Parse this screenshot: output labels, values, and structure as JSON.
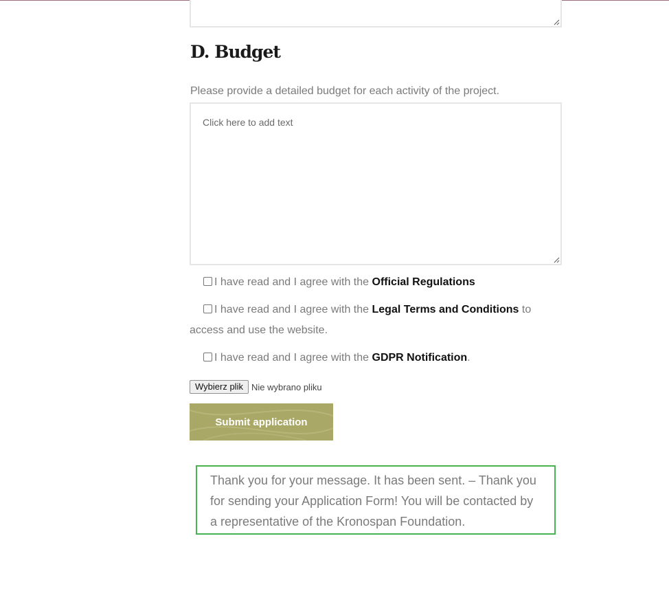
{
  "section": {
    "heading": "D. Budget",
    "instruction": "Please provide a detailed budget for each activity of the project.",
    "budget_placeholder": "Click here to add text"
  },
  "agreements": {
    "prefix": "I have read and I agree with the",
    "regulations_link": "Official Regulations",
    "terms_link": "Legal Terms and Conditions",
    "terms_suffix": "to access and use the website.",
    "gdpr_link": "GDPR Notification",
    "gdpr_suffix": "."
  },
  "file_upload": {
    "button_label": "Wybierz plik",
    "status": "Nie wybrano pliku"
  },
  "submit": {
    "label": "Submit application",
    "color": "#a9a866"
  },
  "response": {
    "message": "Thank you for your message. It has been sent. – Thank you for sending your Application Form! You will be contacted by a representative of the Kronospan Foundation.",
    "border_color": "#46b450"
  }
}
